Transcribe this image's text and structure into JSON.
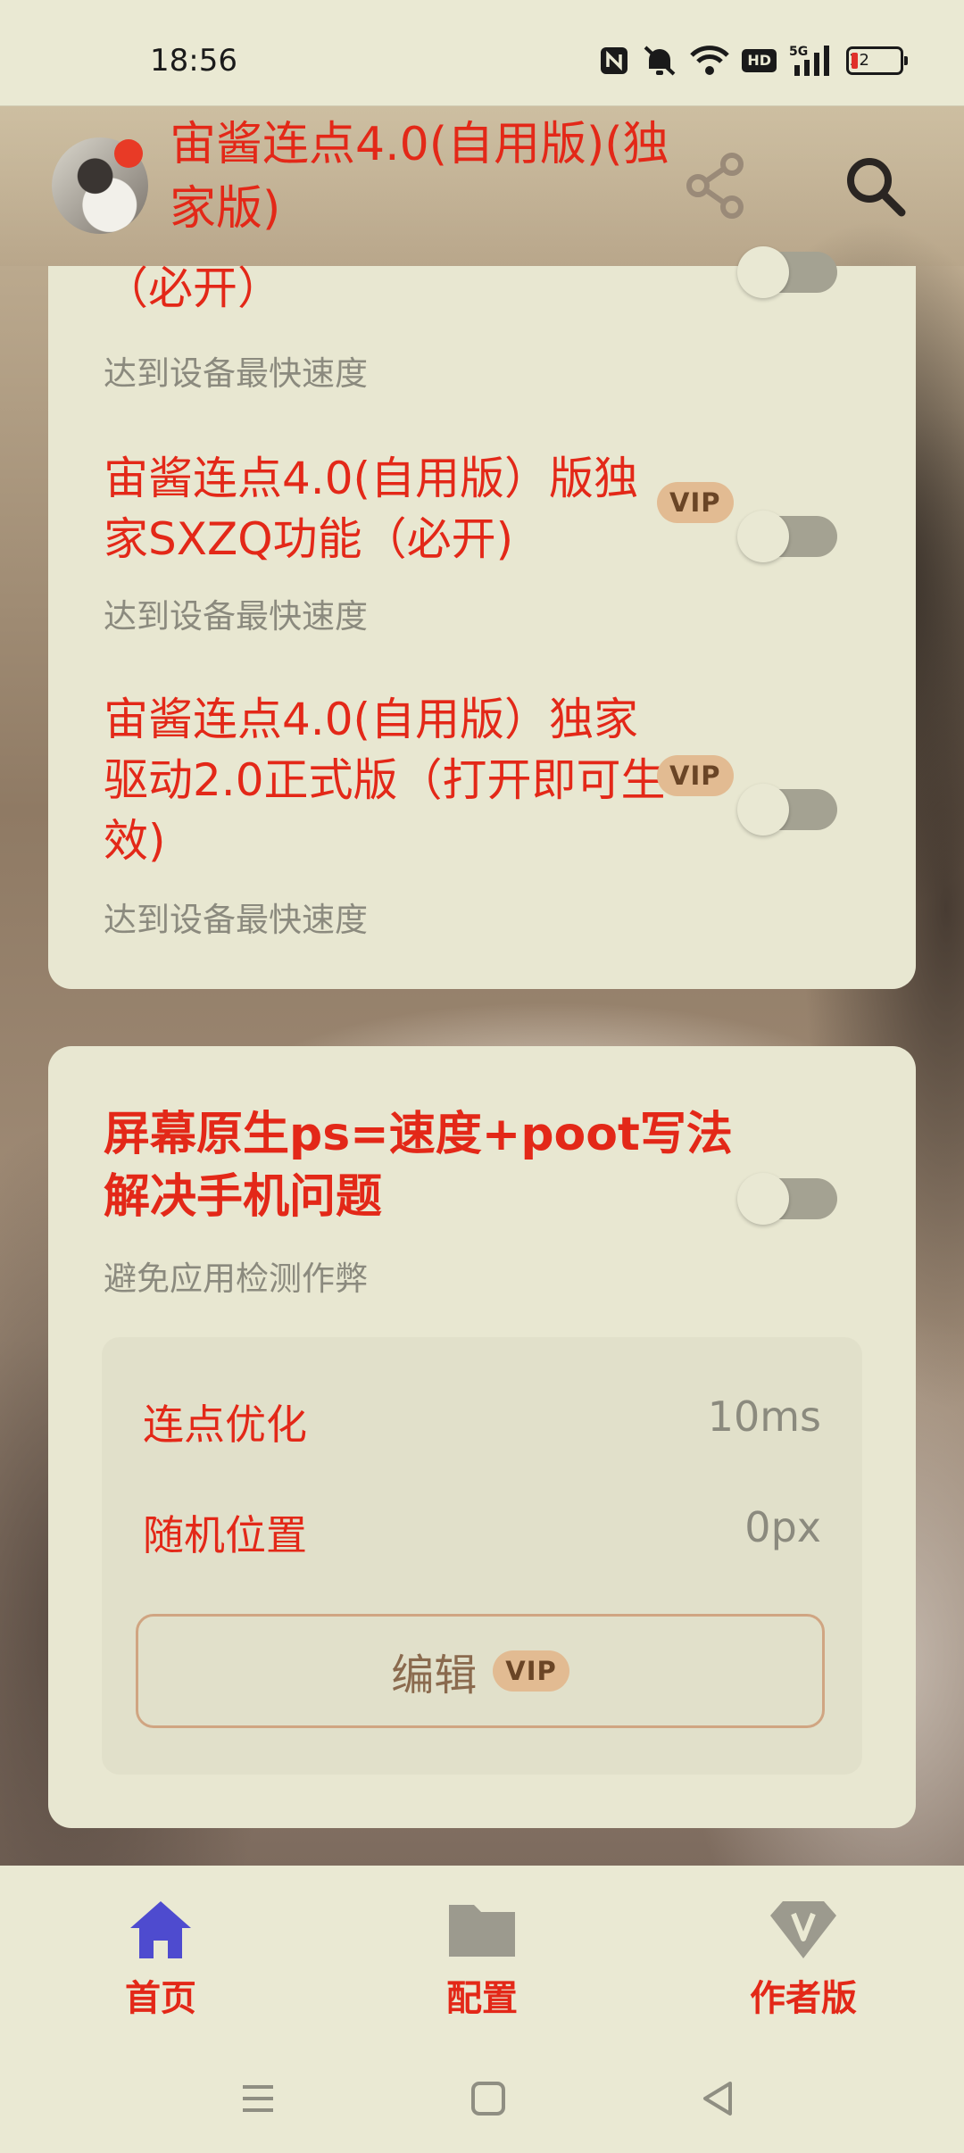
{
  "status_bar": {
    "time": "18:56",
    "icons": [
      "nfc-icon",
      "mute-icon",
      "wifi-icon",
      "hd-icon",
      "5g-signal-icon",
      "battery-icon"
    ],
    "hd_label": "HD",
    "battery_level": "12"
  },
  "app_bar": {
    "title": "宙酱连点4.0(自用版)(独家版)",
    "icons": [
      "share-icon",
      "search-icon"
    ]
  },
  "card1": {
    "partial_title": "（必开）",
    "partial_subtitle": "达到设备最快速度",
    "options": [
      {
        "title": "宙酱连点4.0(自用版）版独家SXZQ功能（必开)",
        "subtitle": "达到设备最快速度",
        "badge": "VIP",
        "enabled": false
      },
      {
        "title": "宙酱连点4.0(自用版）独家驱动2.0正式版（打开即可生效)",
        "subtitle": "达到设备最快速度",
        "badge": "VIP",
        "enabled": false
      }
    ]
  },
  "card2": {
    "title": "屏幕原生ps=速度+poot写法解决手机问题",
    "subtitle": "避免应用检测作弊",
    "enabled": false,
    "rows": [
      {
        "label": "连点优化",
        "value": "10ms"
      },
      {
        "label": "随机位置",
        "value": "0px"
      }
    ],
    "edit_label": "编辑",
    "edit_badge": "VIP"
  },
  "bottom_nav": {
    "items": [
      {
        "label": "首页",
        "icon": "home-icon",
        "active": true
      },
      {
        "label": "配置",
        "icon": "folder-icon",
        "active": false
      },
      {
        "label": "作者版",
        "icon": "vip-diamond-icon",
        "active": false
      }
    ]
  },
  "colors": {
    "accent_red": "#e32818",
    "active_nav_icon": "#4e4bcf",
    "card_bg": "#e8e7d1",
    "vip_badge_bg": "#e2bb92"
  }
}
